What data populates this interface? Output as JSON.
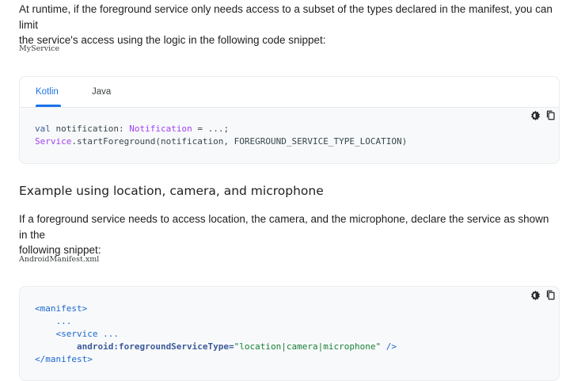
{
  "intro": {
    "line1": "At runtime, if the foreground service only needs access to a subset of the types declared in the manifest, you can limit",
    "line2": "the service's access using the logic in the following code snippet:"
  },
  "snippet1": {
    "file_label": "MyService",
    "tabs": [
      "Kotlin",
      "Java"
    ],
    "selected_tab": "Kotlin",
    "line1": {
      "kw": "val",
      "name": " notification: ",
      "type": "Notification",
      "rest": " = ...;"
    },
    "line2": {
      "type": "Service",
      "rest": ".startForeground(notification, FOREGROUND_SERVICE_TYPE_LOCATION)"
    }
  },
  "section": {
    "heading": "Example using location, camera, and microphone",
    "para_line1": "If a foreground service needs to access location, the camera, and the microphone, declare the service as shown in the",
    "para_line2": "following snippet:"
  },
  "snippet2": {
    "file_label": "AndroidManifest.xml",
    "line1": "<manifest>",
    "line2": "    ...",
    "line3_tag": "    <service ...",
    "line4_attr": "        android:foregroundServiceType=",
    "line4_value": "\"location|camera|microphone\"",
    "line4_end": " />",
    "line5": "</manifest>"
  },
  "icons": {
    "theme": "theme-toggle-icon",
    "copy": "copy-icon"
  }
}
